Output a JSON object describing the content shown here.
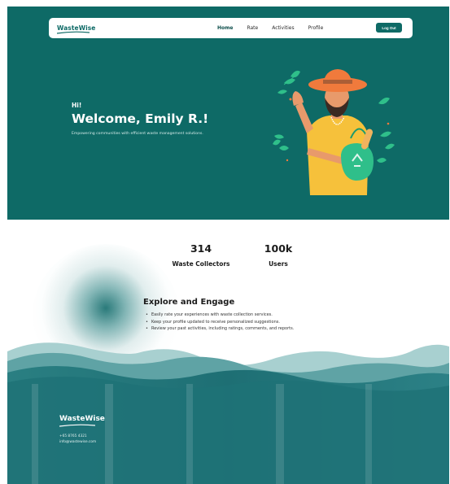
{
  "brand": {
    "name": "WasteWise"
  },
  "nav": {
    "items": [
      {
        "label": "Home",
        "active": true
      },
      {
        "label": "Rate",
        "active": false
      },
      {
        "label": "Activities",
        "active": false
      },
      {
        "label": "Profile",
        "active": false
      }
    ],
    "logout_label": "Log Out"
  },
  "hero": {
    "greeting": "Hi!",
    "welcome": "Welcome, Emily R.!",
    "tagline": "Empowering communities with efficient waste management solutions."
  },
  "stats": [
    {
      "value": "314",
      "label": "Waste Collectors"
    },
    {
      "value": "100k",
      "label": "Users"
    }
  ],
  "explore": {
    "title": "Explore and Engage",
    "items": [
      "Easily rate your experiences with waste collection services.",
      "Keep your profile updated to receive personalized suggestions.",
      "Review your past activities, including ratings, comments, and reports."
    ]
  },
  "footer": {
    "brand": "WasteWise",
    "phone": "+65 8765 4321",
    "email": "info@wastewise.com"
  },
  "colors": {
    "primary": "#0e6a66",
    "accent_orange": "#f07a3c",
    "shirt_yellow": "#f6c13b",
    "leaf_green": "#2fbf8a"
  },
  "icons": {
    "hero_illustration": "man-with-recycle-bag-illustration"
  }
}
